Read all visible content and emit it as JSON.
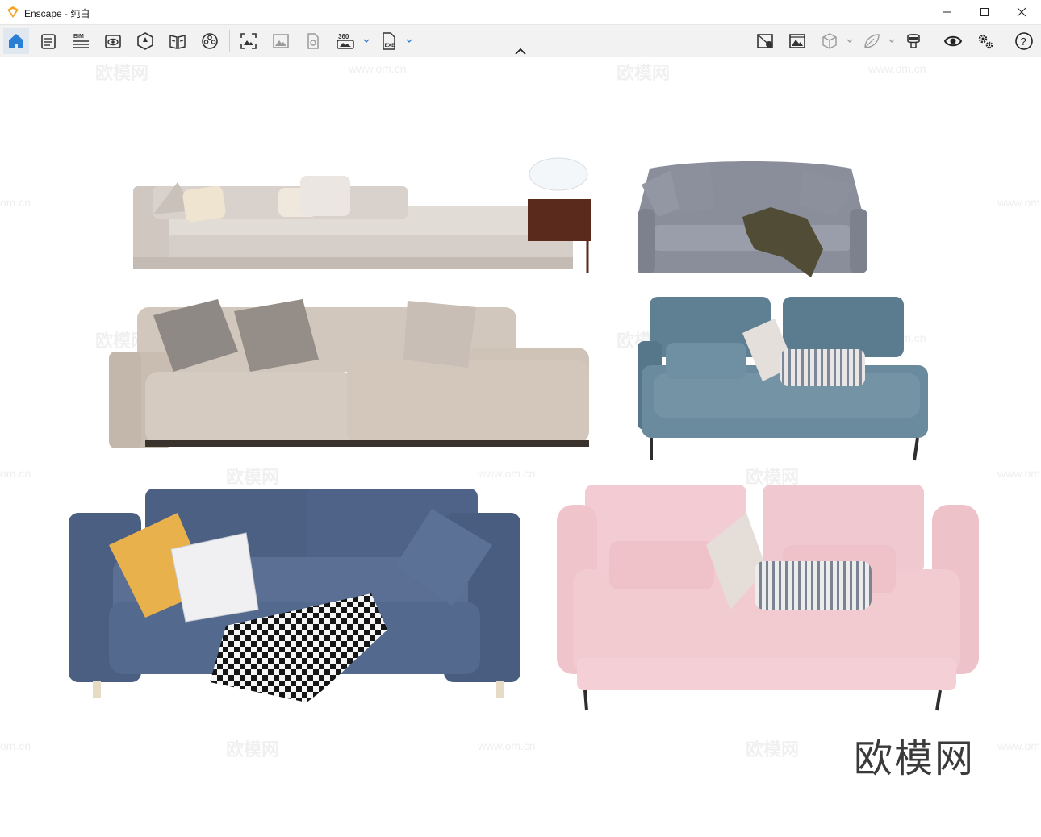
{
  "window": {
    "title": "Enscape - 纯白",
    "min_icon": "minimize-icon",
    "max_icon": "maximize-icon",
    "close_icon": "close-icon"
  },
  "toolbar": {
    "left_tools": [
      {
        "name": "home",
        "icon": "home-icon"
      },
      {
        "name": "notes",
        "icon": "notes-icon"
      },
      {
        "name": "bim",
        "icon": "bim-icon",
        "label": "BIM"
      },
      {
        "name": "views",
        "icon": "view-icon"
      },
      {
        "name": "site-context",
        "icon": "site-icon"
      },
      {
        "name": "asset-library",
        "icon": "library-icon"
      },
      {
        "name": "material-editor",
        "icon": "material-icon"
      },
      {
        "name": "screenshot",
        "icon": "screenshot-icon"
      },
      {
        "name": "batch-render",
        "icon": "batch-render-icon"
      },
      {
        "name": "video-editor",
        "icon": "video-icon"
      },
      {
        "name": "panorama",
        "icon": "panorama-icon",
        "label": "360"
      },
      {
        "name": "export-exe",
        "icon": "exe-icon",
        "label": "EXE"
      }
    ],
    "right_tools": [
      {
        "name": "create-view",
        "icon": "create-view-icon"
      },
      {
        "name": "visual-settings",
        "icon": "image-settings-icon"
      },
      {
        "name": "vr-cube",
        "icon": "cube-icon"
      },
      {
        "name": "feedback",
        "icon": "leaf-icon"
      },
      {
        "name": "vr-headset",
        "icon": "vr-icon"
      },
      {
        "name": "live-view",
        "icon": "eye-icon"
      },
      {
        "name": "settings",
        "icon": "gears-icon"
      },
      {
        "name": "help",
        "icon": "help-icon",
        "label": "?"
      }
    ]
  },
  "viewport": {
    "watermark_text": "欧模网",
    "watermark_url": "www.om.cn",
    "watermark_partial": "om.cn",
    "brand_watermark": "欧模网",
    "sofas": [
      {
        "name": "long-low-sofa",
        "color": "#d9d2cc"
      },
      {
        "name": "grey-loveseat",
        "color": "#8a8e9b"
      },
      {
        "name": "beige-sectional",
        "color": "#cfc3b8"
      },
      {
        "name": "teal-chaise-sofa",
        "color": "#5f7f93"
      },
      {
        "name": "blue-sofa",
        "color": "#4c6185"
      },
      {
        "name": "pink-sofa",
        "color": "#f1c8cf"
      }
    ],
    "side_table": {
      "name": "side-table-with-lamp",
      "color": "#5a2a1c"
    }
  },
  "colors": {
    "accent": "#2a7fd4",
    "logo": "#f3a320"
  }
}
